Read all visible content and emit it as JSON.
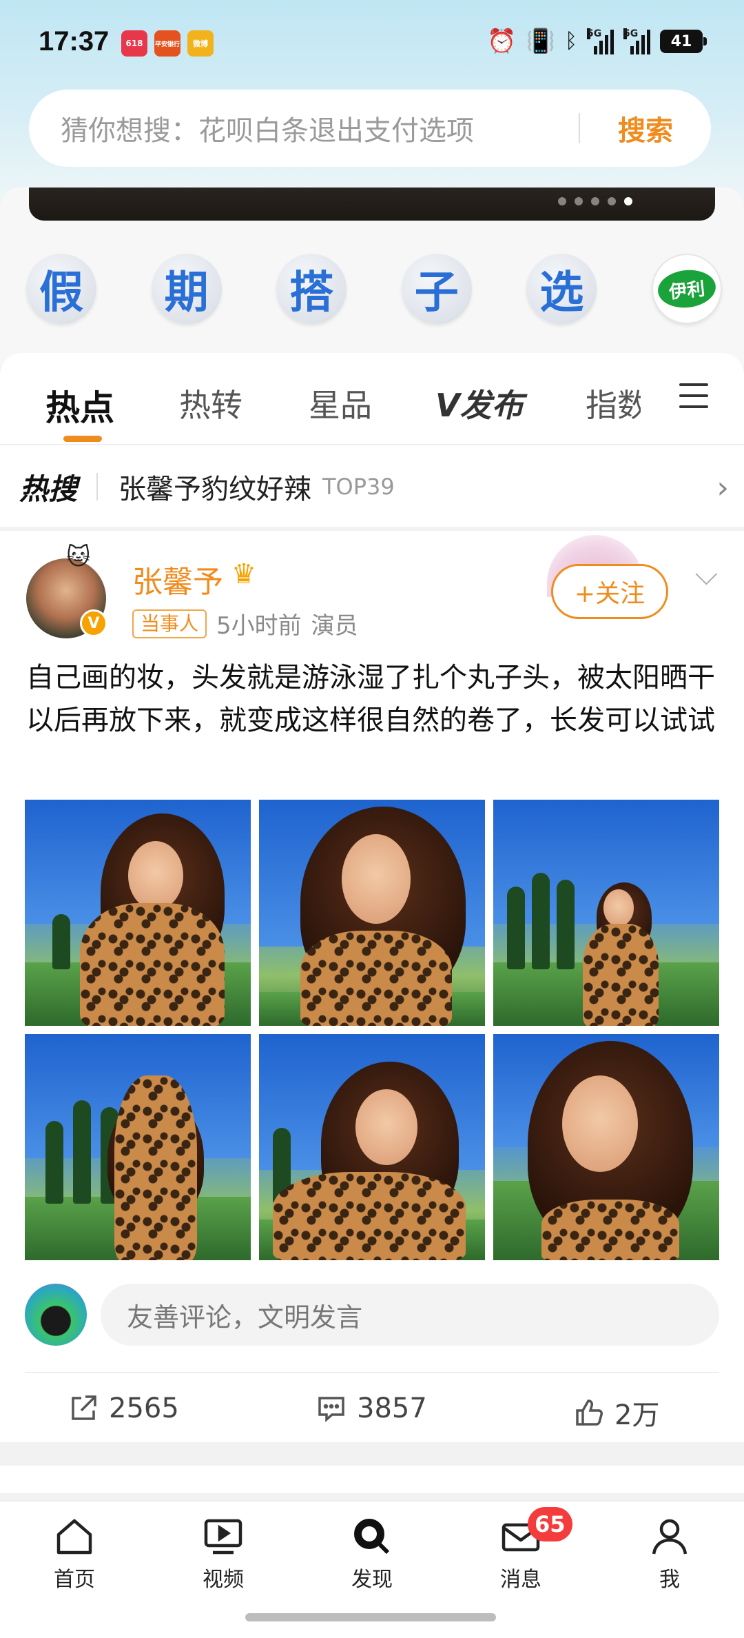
{
  "status": {
    "time": "17:37",
    "apps": [
      {
        "name": "618-app-icon",
        "label": "618",
        "color": "#e8374a"
      },
      {
        "name": "pingan-bank-icon",
        "label": "平安银行",
        "color": "#e4531f"
      },
      {
        "name": "weibo-icon",
        "label": "微博",
        "color": "#f2b21b"
      }
    ],
    "network1": "5G",
    "network2": "5G",
    "battery": "41"
  },
  "search": {
    "placeholder": "猜你想搜：花呗白条退出支付选项",
    "button": "搜索"
  },
  "circles": [
    "假",
    "期",
    "搭",
    "子",
    "选"
  ],
  "brand_logo": "伊利",
  "tabs": {
    "items": [
      "热点",
      "热转",
      "星品",
      "发布",
      "指数"
    ],
    "active": "热点"
  },
  "hot_search": {
    "logo": "热搜",
    "text": "张馨予豹纹好辣",
    "rank": "TOP39"
  },
  "post": {
    "author": "张馨予",
    "role_tag": "当事人",
    "time": "5小时前",
    "profession": "演员",
    "follow": "+关注",
    "text": "自己画的妆，头发就是游泳湿了扎个丸子头，被太阳晒干以后再放下来，就变成这样很自然的卷了，长发可以试试",
    "comment_placeholder": "友善评论，文明发言",
    "shares": "2565",
    "comments": "3857",
    "likes": "2万"
  },
  "nav": {
    "items": [
      {
        "label": "首页",
        "icon": "home-icon"
      },
      {
        "label": "视频",
        "icon": "video-icon"
      },
      {
        "label": "发现",
        "icon": "discover-icon"
      },
      {
        "label": "消息",
        "icon": "mail-icon"
      },
      {
        "label": "我",
        "icon": "profile-icon"
      }
    ],
    "message_badge": "65"
  }
}
